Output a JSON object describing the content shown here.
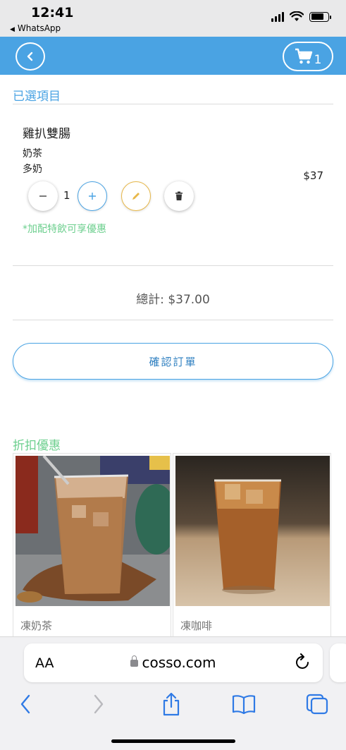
{
  "status_bar": {
    "time": "12:41",
    "back_app": "WhatsApp"
  },
  "header": {
    "back_icon": "chevron-left-icon",
    "cart_icon": "cart-icon",
    "cart_count": "1",
    "color": "#4aa3e3"
  },
  "selected": {
    "title": "已選項目",
    "item": {
      "name": "雞扒雙腸",
      "options": [
        "奶茶",
        "多奶"
      ],
      "price": "$37",
      "quantity": "1"
    },
    "promo_note": "*加配特飲可享優惠"
  },
  "total": {
    "text": "總計: $37.00"
  },
  "confirm": {
    "label": "確認訂單"
  },
  "discount": {
    "title": "折扣優惠",
    "products": [
      {
        "name": "凍奶茶"
      },
      {
        "name": "凍咖啡"
      }
    ]
  },
  "browser": {
    "aa_label": "AA",
    "url": "cosso.com"
  },
  "colors": {
    "accent": "#4aa3e3",
    "green": "#6ccf8e",
    "edit": "#e8b84a"
  }
}
